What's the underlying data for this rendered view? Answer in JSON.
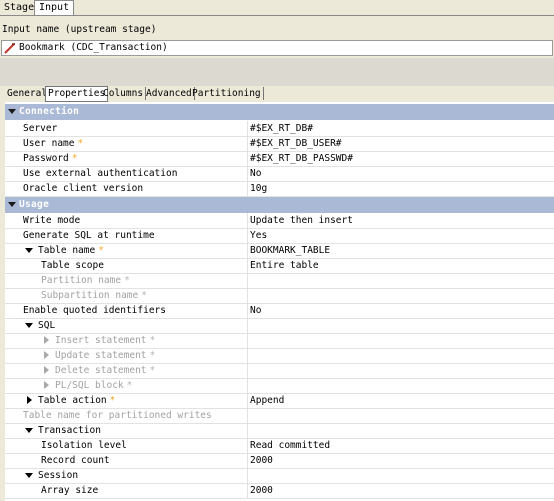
{
  "top_tabs": {
    "stage": "Stage",
    "input": "Input"
  },
  "input_name_label": "Input name (upstream stage)",
  "input_name_value": "Bookmark (CDC_Transaction)",
  "sub_tabs": [
    "General",
    "Properties",
    "Columns",
    "Advanced",
    "Partitioning"
  ],
  "sections": {
    "connection": "Connection",
    "usage": "Usage"
  },
  "rows": {
    "server": {
      "label": "Server",
      "value": "#$EX_RT_DB#"
    },
    "user_name": {
      "label": "User name",
      "value": "#$EX_RT_DB_USER#"
    },
    "password": {
      "label": "Password",
      "value": "#$EX_RT_DB_PASSWD#"
    },
    "use_ext_auth": {
      "label": "Use external authentication",
      "value": "No"
    },
    "oracle_client": {
      "label": "Oracle client version",
      "value": "10g"
    },
    "write_mode": {
      "label": "Write mode",
      "value": "Update then insert"
    },
    "gen_sql": {
      "label": "Generate SQL at runtime",
      "value": "Yes"
    },
    "table_name": {
      "label": "Table name",
      "value": "BOOKMARK_TABLE"
    },
    "table_scope": {
      "label": "Table scope",
      "value": "Entire table"
    },
    "partition_name": {
      "label": "Partition name",
      "value": ""
    },
    "subpartition_name": {
      "label": "Subpartition name",
      "value": ""
    },
    "enable_quoted": {
      "label": "Enable quoted identifiers",
      "value": "No"
    },
    "sql": {
      "label": "SQL",
      "value": ""
    },
    "insert_stmt": {
      "label": "Insert statement",
      "value": ""
    },
    "update_stmt": {
      "label": "Update statement",
      "value": ""
    },
    "delete_stmt": {
      "label": "Delete statement",
      "value": ""
    },
    "plsql_block": {
      "label": "PL/SQL block",
      "value": ""
    },
    "table_action": {
      "label": "Table action",
      "value": "Append"
    },
    "table_name_partitioned": {
      "label": "Table name for partitioned writes",
      "value": ""
    },
    "transaction": {
      "label": "Transaction",
      "value": ""
    },
    "isolation_level": {
      "label": "Isolation level",
      "value": "Read committed"
    },
    "record_count": {
      "label": "Record count",
      "value": "2000"
    },
    "session": {
      "label": "Session",
      "value": ""
    },
    "array_size": {
      "label": "Array size",
      "value": "2000"
    }
  },
  "required_marker": "*",
  "colors": {
    "section_band": "#a9b9d6",
    "required": "#f5a623",
    "disabled_text": "#a2a2a2"
  }
}
